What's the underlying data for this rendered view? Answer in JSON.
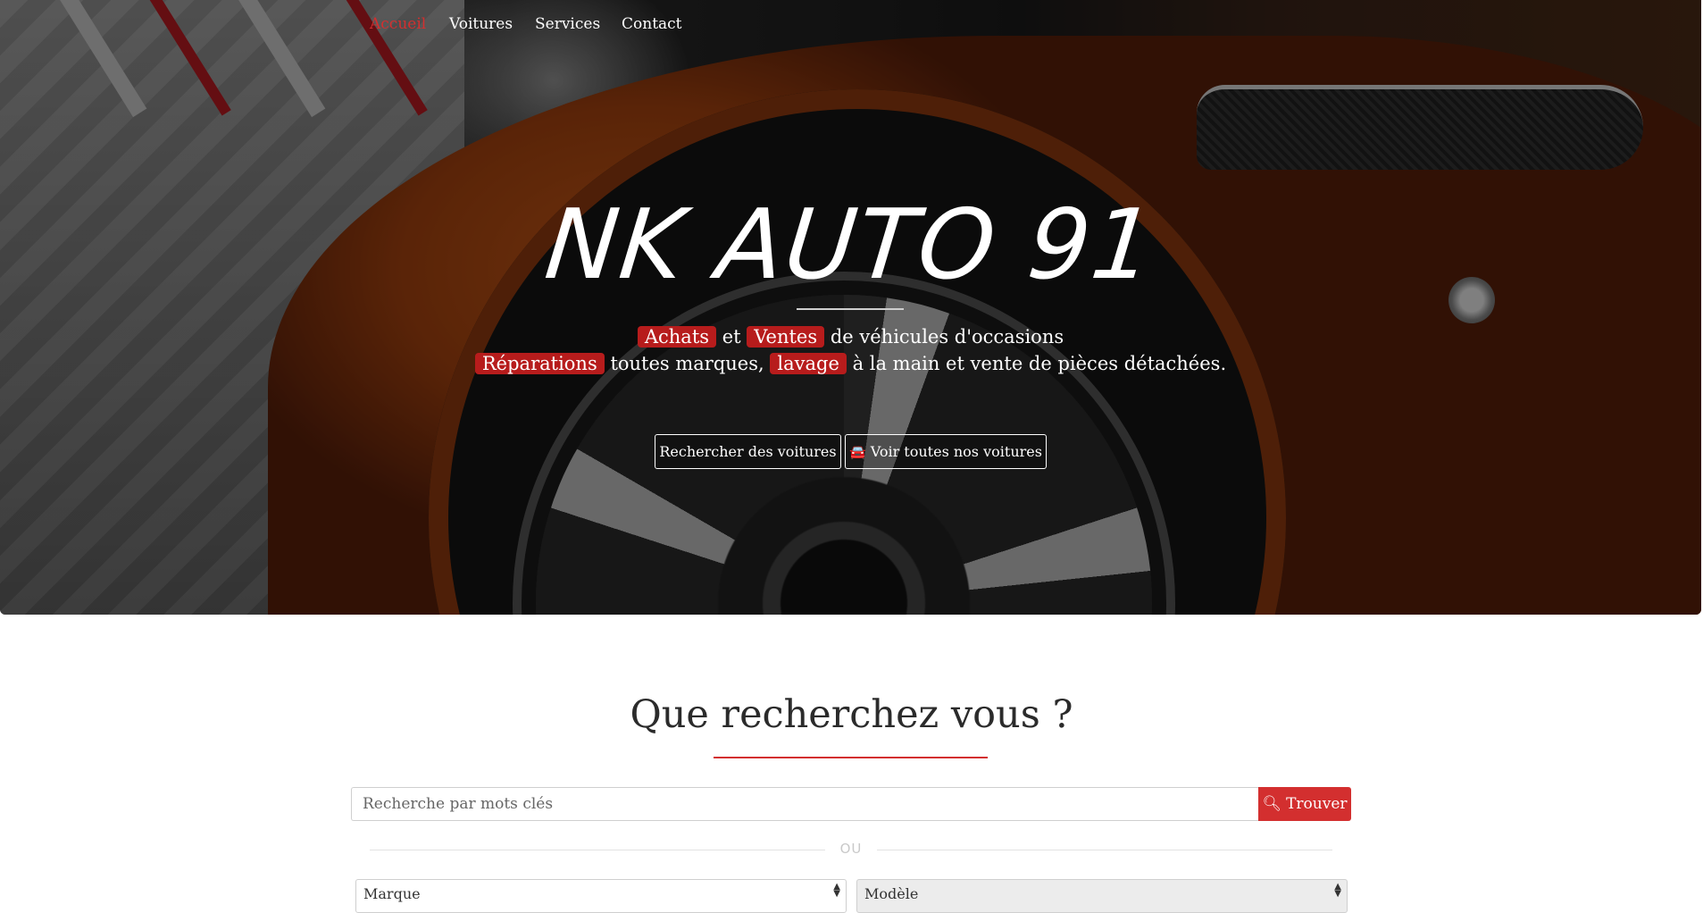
{
  "nav": {
    "items": [
      {
        "label": "Accueil",
        "active": true
      },
      {
        "label": "Voitures",
        "active": false
      },
      {
        "label": "Services",
        "active": false
      },
      {
        "label": "Contact",
        "active": false
      }
    ]
  },
  "hero": {
    "brand": "NK AUTO 91",
    "line1": {
      "hl1": "Achats",
      "t1": "et",
      "hl2": "Ventes",
      "t2": "de véhicules d'occasions"
    },
    "line2": {
      "hl1": "Réparations",
      "t1": "toutes marques,",
      "hl2": "lavage",
      "t2": "à la main et vente de pièces détachées."
    },
    "btn_search": "Rechercher des voitures",
    "btn_all": "Voir toutes nos voitures",
    "btn_all_icon": "car-icon"
  },
  "search": {
    "title": "Que recherchez vous ?",
    "placeholder": "Recherche par mots clés",
    "button": "Trouver",
    "button_icon": "search-icon",
    "or_label": "OU",
    "brand_select": "Marque",
    "model_select": "Modèle"
  },
  "colors": {
    "accent": "#d32f2f",
    "highlight": "#b71c1c"
  }
}
